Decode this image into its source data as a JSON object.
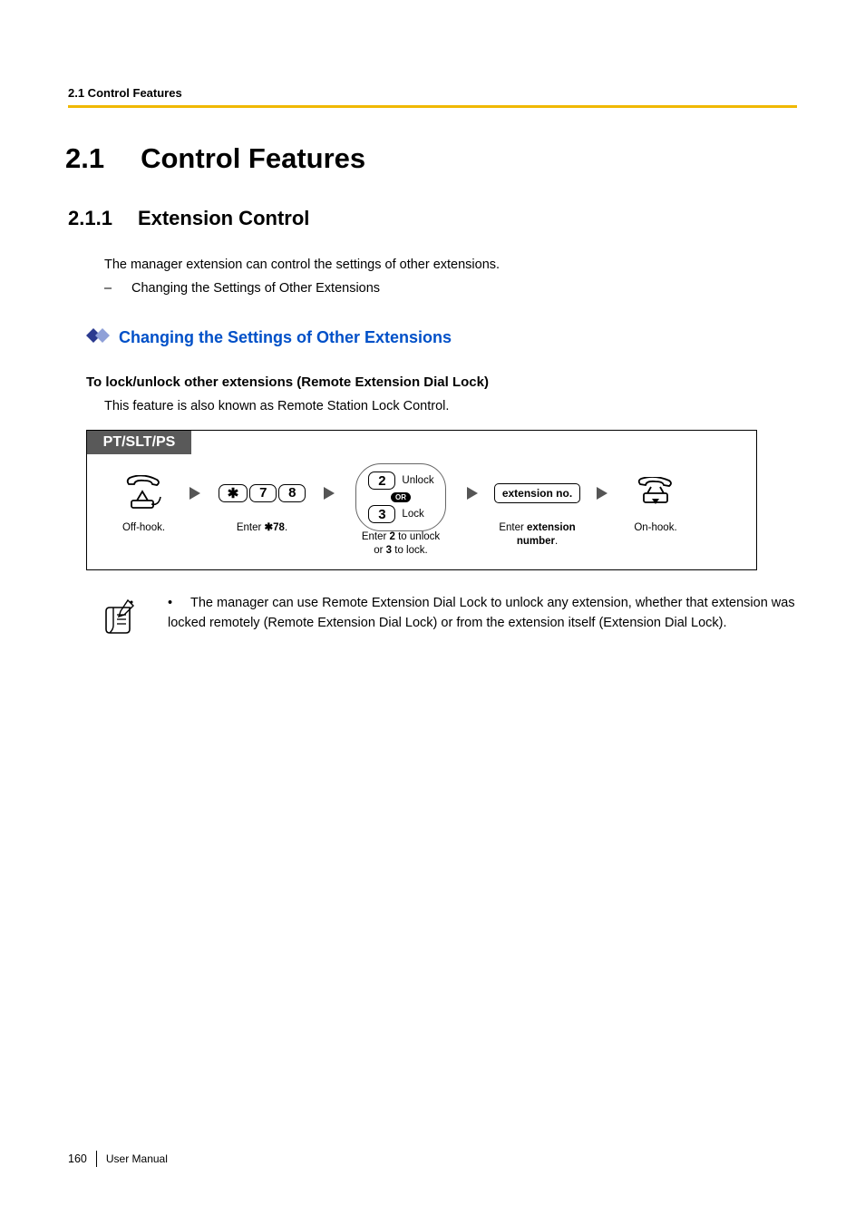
{
  "header": {
    "running_head": "2.1 Control Features"
  },
  "section": {
    "number": "2.1",
    "title": "Control Features"
  },
  "subsection": {
    "number": "2.1.1",
    "title": "Extension Control",
    "intro": "The manager extension can control the settings of other extensions.",
    "bullet_item": "Changing the Settings of Other Extensions"
  },
  "blue_heading": "Changing the Settings of Other Extensions",
  "procedure": {
    "title": "To lock/unlock other extensions (Remote Extension Dial Lock)",
    "description": "This feature is also known as Remote Station Lock Control.",
    "tab": "PT/SLT/PS",
    "steps": {
      "offhook_caption": "Off-hook.",
      "dial_keys": [
        "✱",
        "7",
        "8"
      ],
      "dial_caption_prefix": "Enter ",
      "dial_caption_code": "✱78",
      "unlock_key": "2",
      "unlock_label": "Unlock",
      "or_label": "OR",
      "lock_key": "3",
      "lock_label": "Lock",
      "lock_caption_l1_prefix": "Enter ",
      "lock_caption_l1_bold": "2",
      "lock_caption_l1_suffix": " to unlock",
      "lock_caption_l2_prefix": "or ",
      "lock_caption_l2_bold": "3",
      "lock_caption_l2_suffix": " to lock.",
      "ext_box": "extension no.",
      "ext_caption_prefix": "Enter ",
      "ext_caption_bold1": "extension",
      "ext_caption_bold2": "number",
      "onhook_caption": "On-hook."
    }
  },
  "note": {
    "text": "The manager can use Remote Extension Dial Lock to unlock any extension, whether that extension was locked remotely (Remote Extension Dial Lock) or from the extension itself (Extension Dial Lock)."
  },
  "footer": {
    "page_number": "160",
    "doc_label": "User Manual"
  }
}
